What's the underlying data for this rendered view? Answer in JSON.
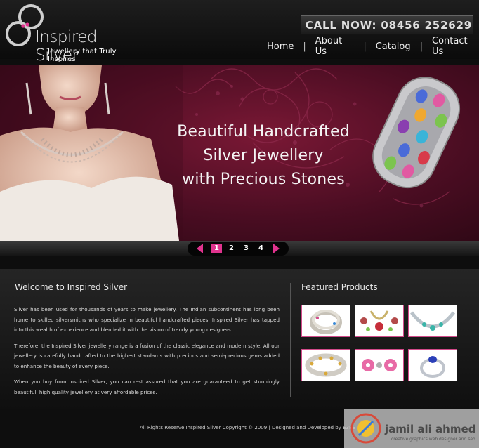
{
  "brand": {
    "name": "Inspired Silver",
    "tagline": "Jewellery that Truly Inspires",
    "logo_icon": "interlocking-rings-logo"
  },
  "header": {
    "call_now": "CALL NOW: 08456 252629"
  },
  "nav": {
    "items": [
      "Home",
      "About Us",
      "Catalog",
      "Contact Us"
    ],
    "separator": "|"
  },
  "banner": {
    "headline": [
      "Beautiful Handcrafted",
      "Silver Jewellery",
      "with Precious Stones"
    ],
    "pages": [
      "1",
      "2",
      "3",
      "4"
    ],
    "active_page": "1",
    "accent_color": "#e0338e"
  },
  "welcome": {
    "title": "Welcome to Inspired Silver",
    "paragraphs": [
      "Silver has been used for thousands of years to make jewellery. The Indian subcontinent has long been home to skilled silversmiths who specialize in beautiful handcrafted pieces. Inspired Silver has tapped into this wealth of experience and blended it with the vision of trendy young designers.",
      "Therefore, the Inspired Silver jewellery range is a fusion of the classic elegance and modern style. All our jewellery is carefully handcrafted to the highest standards with precious and semi-precious gems added to enhance the beauty of every piece.",
      "When you buy from Inspired Silver, you can rest assured that you are guaranteed to get stunningly beautiful, high quality jewellery at very affordable prices."
    ]
  },
  "featured": {
    "title": "Featured Products",
    "products": [
      {
        "icon": "bangles-image"
      },
      {
        "icon": "earrings-set-image"
      },
      {
        "icon": "necklace-image"
      },
      {
        "icon": "bracelet-image"
      },
      {
        "icon": "flower-earrings-image"
      },
      {
        "icon": "ring-image"
      }
    ]
  },
  "footer": {
    "copyright": "All Rights Reserve Inspired Silver Copyright © 2009 | Designed and Developed by E3BS"
  },
  "watermark": {
    "name": "jamil ali ahmed",
    "subtitle": "creative graphics web designer and seo"
  },
  "colors": {
    "background": "#0e0e0e",
    "banner": "#5a1029",
    "accent": "#e0338e",
    "thumb_border": "#d24a8a"
  }
}
